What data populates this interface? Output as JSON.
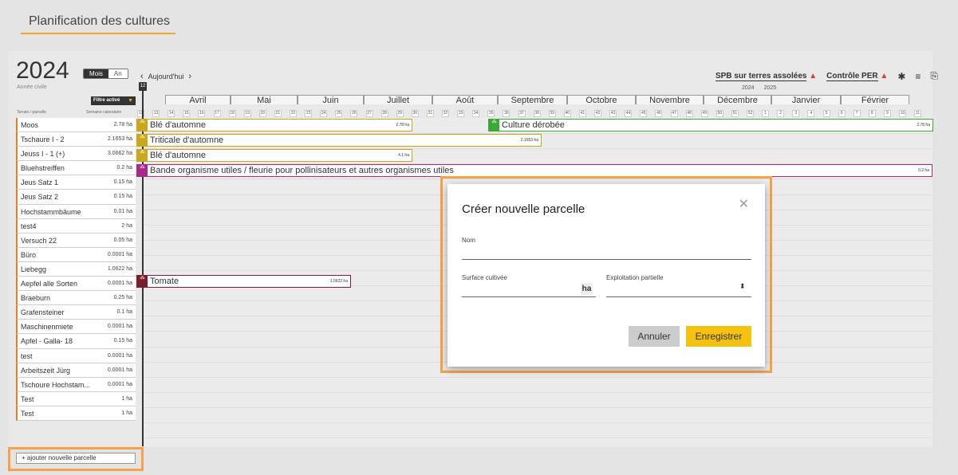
{
  "header": {
    "title": "Planification des cultures"
  },
  "planner": {
    "year": "2024",
    "year_subtitle": "Année civile",
    "view_month": "Mois",
    "view_year": "An",
    "today": "Aujourd'hui",
    "today_week": "12",
    "filter_label": "Filtre activé",
    "col_parcel": "Terrain / parcelle",
    "col_week": "Semaine calendaire",
    "spb_link": "SPB sur terres assolées",
    "per_link": "Contrôle PER",
    "year_a": "2024",
    "year_b": "2025",
    "months": [
      "Avril",
      "Mai",
      "Juin",
      "Juillet",
      "Août",
      "Septembre",
      "Octobre",
      "Novembre",
      "Décembre",
      "Janvier",
      "Février"
    ],
    "weeks": [
      "12",
      "13",
      "14",
      "15",
      "16",
      "17",
      "18",
      "19",
      "20",
      "21",
      "22",
      "23",
      "24",
      "25",
      "26",
      "27",
      "28",
      "29",
      "30",
      "31",
      "32",
      "33",
      "34",
      "35",
      "36",
      "37",
      "38",
      "39",
      "40",
      "41",
      "42",
      "43",
      "44",
      "45",
      "46",
      "47",
      "48",
      "49",
      "50",
      "51",
      "52",
      "1",
      "2",
      "3",
      "4",
      "5",
      "6",
      "7",
      "8",
      "9",
      "10",
      "11"
    ],
    "add_parcel": "+ ajouter nouvelle parcelle"
  },
  "parcels": [
    {
      "name": "Moos",
      "area": "2.78 ha"
    },
    {
      "name": "Tschaure I - 2",
      "area": "2.1653 ha"
    },
    {
      "name": "Jeuss I - 1 (+)",
      "area": "3.0662 ha"
    },
    {
      "name": "Bluehstreiffen",
      "area": "0.2 ha"
    },
    {
      "name": "Jeus Satz 1",
      "area": "0.15 ha"
    },
    {
      "name": "Jeus Satz 2",
      "area": "0.15 ha"
    },
    {
      "name": "Hochstammbäume",
      "area": "0.01 ha"
    },
    {
      "name": "test4",
      "area": "2 ha"
    },
    {
      "name": "Versuch 22",
      "area": "0.05 ha"
    },
    {
      "name": "Büro",
      "area": "0.0001 ha"
    },
    {
      "name": "Liebegg",
      "area": "1.0622 ha"
    },
    {
      "name": "Aepfel alle Sorten",
      "area": "0.0001 ha"
    },
    {
      "name": "Braeburn",
      "area": "0.25 ha"
    },
    {
      "name": "Grafensteiner",
      "area": "0.1 ha"
    },
    {
      "name": "Maschinenmiete",
      "area": "0.0001 ha"
    },
    {
      "name": "Apfel - Galla- 18",
      "area": "0.15 ha"
    },
    {
      "name": "test",
      "area": "0.0001 ha"
    },
    {
      "name": "Arbeitszeit Jürg",
      "area": "0.0001 ha"
    },
    {
      "name": "Tschoure Hochstam...",
      "area": "0.0001 ha"
    },
    {
      "name": "Test",
      "area": "1 ha"
    },
    {
      "name": "Test",
      "area": "1 ha"
    }
  ],
  "crops": [
    {
      "name": "Blé d'automne",
      "area": "2.78 ha",
      "color": "#c9a820"
    },
    {
      "name": "Culture dérobée",
      "area": "2.78 ha",
      "color": "#3aa935"
    },
    {
      "name": "Triticale d'automne",
      "area": "2.1653 ha",
      "color": "#c9a820"
    },
    {
      "name": "Blé d'automne",
      "area": "4.1 ha",
      "color": "#c9a820"
    },
    {
      "name": "Bande organisme utiles / fleurie pour pollinisateurs et autres organismes utiles",
      "area": "0.2 ha",
      "color": "#a8288e"
    },
    {
      "name": "Tomate",
      "area": "1.0622 ha",
      "color": "#7a1e2e"
    }
  ],
  "modal": {
    "title": "Créer nouvelle parcelle",
    "name_label": "Nom",
    "surface_label": "Surface cultivée",
    "unit": "ha",
    "partial_label": "Exploitation partielle",
    "cancel": "Annuler",
    "save": "Enregistrer"
  }
}
